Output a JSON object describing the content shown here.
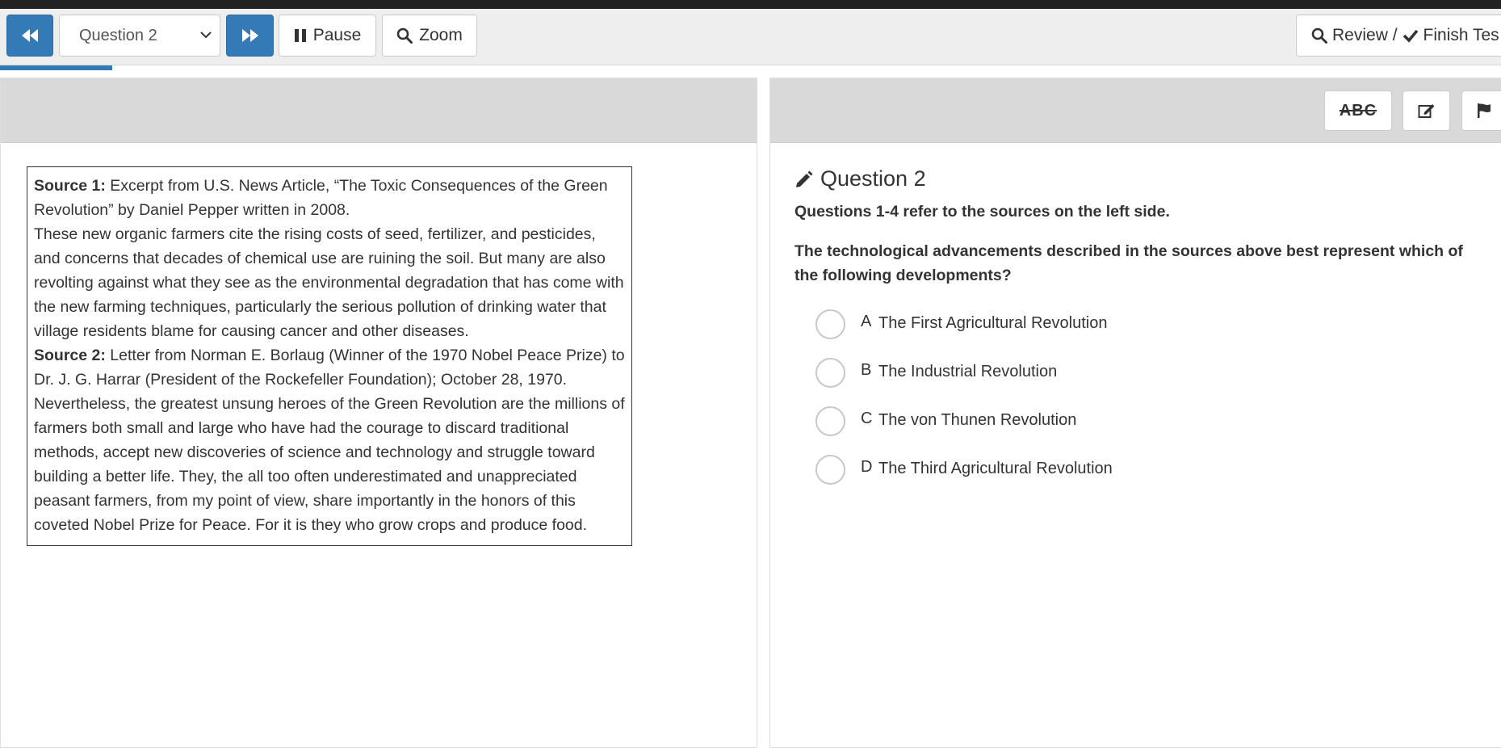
{
  "toolbar": {
    "question_select_value": "Question 2",
    "pause_label": "Pause",
    "zoom_label": "Zoom",
    "review_label": "Review /",
    "finish_label": "Finish Tes"
  },
  "progress": {
    "value": 0.075
  },
  "right_tools": {
    "strikethrough_label": "ABC"
  },
  "sources": {
    "source1_label": "Source 1:",
    "source1_citation": " Excerpt from U.S. News Article, “The Toxic Consequences of the Green Revolution” by Daniel Pepper written in 2008.",
    "source1_text": "These new organic farmers cite the rising costs of seed, fertilizer, and pesticides, and concerns that decades of chemical use are ruining the soil. But many are also revolting against what they see as the environmental degradation that has come with the new farming techniques, particularly the serious pollution of drinking water that village residents blame for causing cancer and other diseases.",
    "source2_label": "Source 2:",
    "source2_citation": " Letter from Norman E. Borlaug (Winner of the 1970 Nobel Peace Prize) to Dr. J. G. Harrar (President of the Rockefeller Foundation); October 28, 1970.",
    "source2_text": "Nevertheless, the greatest unsung heroes of the Green Revolution are the millions of farmers both small and large who have had the courage to discard traditional methods, accept new discoveries of science and technology and struggle toward building a better life. They, the all too often underestimated and unappreciated peasant farmers, from my point of view, share importantly in the honors of this coveted Nobel Prize for Peace. For it is they who grow crops and produce food."
  },
  "question": {
    "title": "Question 2",
    "instructions": "Questions 1-4 refer to the sources on the left side.",
    "stem": "The technological advancements described in the sources above best represent which of the following developments?",
    "choices": [
      {
        "letter": "A",
        "text": "The First Agricultural Revolution"
      },
      {
        "letter": "B",
        "text": "The Industrial Revolution"
      },
      {
        "letter": "C",
        "text": "The von Thunen Revolution"
      },
      {
        "letter": "D",
        "text": "The Third Agricultural Revolution"
      }
    ]
  },
  "colors": {
    "primary": "#337ab7",
    "top_bar": "#222222",
    "toolbar_bg": "#eeeeee",
    "panel_header_bg": "#d9d9d9"
  }
}
